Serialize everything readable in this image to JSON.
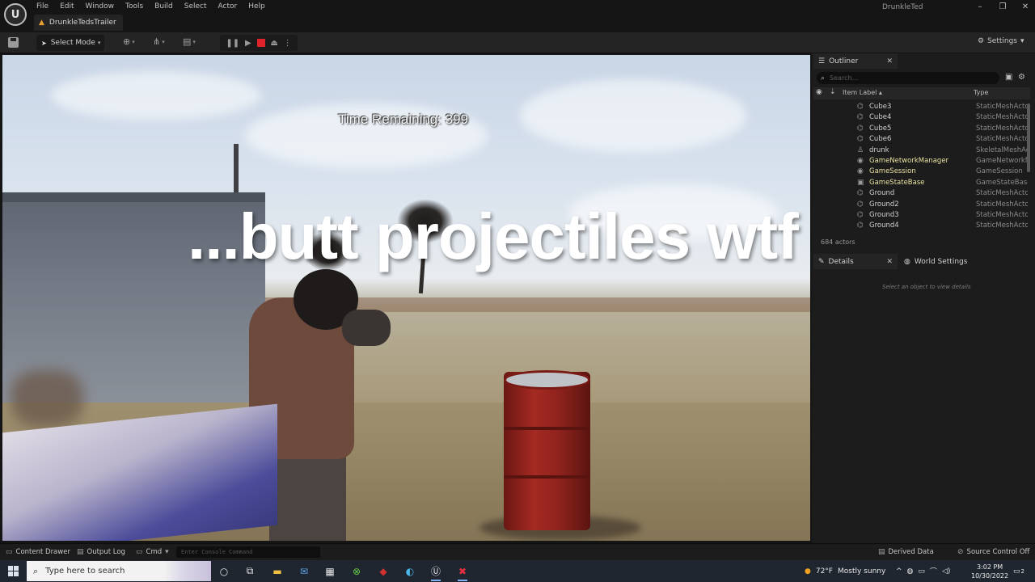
{
  "app": {
    "menu": [
      "File",
      "Edit",
      "Window",
      "Tools",
      "Build",
      "Select",
      "Actor",
      "Help"
    ],
    "project_tab": "DrunkleTedsTrailer",
    "project_name": "DrunkleTed",
    "window_controls": {
      "minimize": "–",
      "maximize": "❐",
      "close": "✕"
    }
  },
  "toolbar": {
    "select_mode": "Select Mode",
    "settings": "Settings"
  },
  "viewport": {
    "hud_time": "Time Remaining: 399",
    "caption": "...butt projectiles wtf"
  },
  "outliner": {
    "tab": "Outliner",
    "search_placeholder": "Search...",
    "col_label": "Item Label ▴",
    "col_type": "Type",
    "rows": [
      {
        "icon": "mesh-icon",
        "name": "Cube3",
        "type": "StaticMeshActo"
      },
      {
        "icon": "mesh-icon",
        "name": "Cube4",
        "type": "StaticMeshActo"
      },
      {
        "icon": "mesh-icon",
        "name": "Cube5",
        "type": "StaticMeshActo"
      },
      {
        "icon": "mesh-icon",
        "name": "Cube6",
        "type": "StaticMeshActo"
      },
      {
        "icon": "skeletal-icon",
        "name": "drunk",
        "type": "SkeletalMeshAc"
      },
      {
        "icon": "network-icon",
        "name": "GameNetworkManager",
        "type": "GameNetworkM"
      },
      {
        "icon": "network-icon",
        "name": "GameSession",
        "type": "GameSession"
      },
      {
        "icon": "state-icon",
        "name": "GameStateBase",
        "type": "GameStateBase"
      },
      {
        "icon": "mesh-icon",
        "name": "Ground",
        "type": "StaticMeshActo"
      },
      {
        "icon": "mesh-icon",
        "name": "Ground2",
        "type": "StaticMeshActo"
      },
      {
        "icon": "mesh-icon",
        "name": "Ground3",
        "type": "StaticMeshActo"
      },
      {
        "icon": "mesh-icon",
        "name": "Ground4",
        "type": "StaticMeshActo"
      }
    ],
    "actor_count": "684 actors"
  },
  "details": {
    "tab": "Details",
    "world_tab": "World Settings",
    "hint": "Select an object to view details"
  },
  "statusbar": {
    "content_drawer": "Content Drawer",
    "output_log": "Output Log",
    "cmd": "Cmd",
    "console_placeholder": "Enter Console Command",
    "derived_data": "Derived Data",
    "source_control": "Source Control Off"
  },
  "taskbar": {
    "search_placeholder": "Type here to search",
    "weather_temp": "72°F",
    "weather_desc": "Mostly sunny",
    "time": "3:02 PM",
    "date": "10/30/2022",
    "notification_count": "2"
  }
}
